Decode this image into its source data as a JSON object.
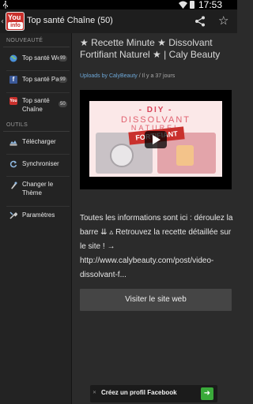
{
  "status_bar": {
    "time": "17:53",
    "icons": [
      "usb-icon",
      "wifi-icon",
      "battery-icon"
    ]
  },
  "action_bar": {
    "app_icon_top": "You",
    "app_icon_bottom": "info",
    "title": "Top santé Chaîne (50)",
    "icons": [
      "share-icon",
      "star-icon"
    ]
  },
  "sidebar": {
    "section_favorites": "NOUVEAUTÉ",
    "items": [
      {
        "label": "Top santé Web",
        "count": "99",
        "icon": "globe-icon"
      },
      {
        "label": "Top santé Page",
        "count": "99",
        "icon": "facebook-icon"
      },
      {
        "label": "Top santé Chaîne",
        "label_line2": "Chaîne",
        "label_line1": "Top santé",
        "count": "50",
        "icon": "youtube-icon"
      }
    ],
    "section_tools": "OUTILS",
    "tools": [
      {
        "label": "Télécharger",
        "icon": "download-icon"
      },
      {
        "label": "Synchroniser",
        "icon": "sync-icon"
      },
      {
        "label_line1": "Changer le",
        "label_line2": "Thème",
        "icon": "theme-icon"
      },
      {
        "label": "Paramètres",
        "icon": "settings-icon"
      }
    ]
  },
  "video": {
    "title": "★ Recette Minute ★ Dissolvant Fortifiant Naturel ★ | Caly Beauty",
    "uploader": "Uploads by CalyBeauty",
    "age": " / Il y a 37 jours",
    "thumb_diy": "- DIY -",
    "thumb_dissolvant": "DISSOLVANT",
    "thumb_naturel": "NATUREL",
    "thumb_ribbon": "FORTIFIANT",
    "description": "Toutes les informations sont ici : déroulez la barre ⇊ ▵ Retrouvez la recette détaillée sur le site ! → http://www.calybeauty.com/post/video-dissolvant-f...",
    "visit_button": "Visiter le site web"
  },
  "ad": {
    "text": "Créez un profil Facebook",
    "arrow": "➜",
    "close": "✕"
  },
  "colors": {
    "background": "#2b2b2b",
    "sidebar": "#232323",
    "link": "#6ea8d8",
    "ad_button": "#3aaa3a",
    "brand_red": "#c9302c"
  }
}
